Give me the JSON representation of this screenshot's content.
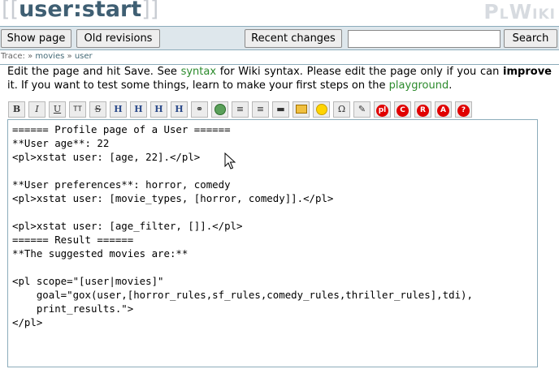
{
  "header": {
    "open_brackets": "[[",
    "page_name": "user:start",
    "close_brackets": "]]",
    "logo_big_p": "P",
    "logo_small_l": "L",
    "logo_big_w": "W",
    "logo_small_iki": "IKI"
  },
  "buttons": {
    "show_page": "Show page",
    "old_revisions": "Old revisions",
    "recent_changes": "Recent changes",
    "search": "Search"
  },
  "search": {
    "value": ""
  },
  "trace": {
    "label": "Trace:",
    "sep": "»",
    "items": [
      "movies",
      "user"
    ]
  },
  "intro": {
    "part1": "Edit the page and hit ",
    "save": "Save",
    "part2": ". See ",
    "syntax_link": "syntax",
    "part3": " for Wiki syntax. Please edit the page only if you can ",
    "improve": "improve",
    "part4": " it. If you want to test some things, learn to make your first steps on the ",
    "playground_link": "playground",
    "part5": "."
  },
  "toolbar": {
    "icons": [
      {
        "name": "bold-icon",
        "glyph": "B"
      },
      {
        "name": "italic-icon",
        "glyph": "I"
      },
      {
        "name": "underline-icon",
        "glyph": "U"
      },
      {
        "name": "monospace-icon",
        "glyph": "TT"
      },
      {
        "name": "strikethrough-icon",
        "glyph": "S"
      },
      {
        "name": "heading-same-icon",
        "glyph": "H"
      },
      {
        "name": "heading-lower-icon",
        "glyph": "H"
      },
      {
        "name": "heading-higher-icon",
        "glyph": "H"
      },
      {
        "name": "heading-menu-icon",
        "glyph": "H"
      },
      {
        "name": "link-icon",
        "glyph": "⚭"
      },
      {
        "name": "external-link-icon",
        "glyph": "globe"
      },
      {
        "name": "ordered-list-icon",
        "glyph": "≡"
      },
      {
        "name": "unordered-list-icon",
        "glyph": "≡"
      },
      {
        "name": "horizontal-rule-icon",
        "glyph": "▬"
      },
      {
        "name": "image-icon",
        "glyph": "img"
      },
      {
        "name": "smiley-icon",
        "glyph": "smile"
      },
      {
        "name": "special-chars-icon",
        "glyph": "Ω"
      },
      {
        "name": "signature-icon",
        "glyph": "✎"
      },
      {
        "name": "pl-icon",
        "glyph": "pl"
      },
      {
        "name": "c-icon",
        "glyph": "C"
      },
      {
        "name": "r-icon",
        "glyph": "R"
      },
      {
        "name": "a-icon",
        "glyph": "A"
      },
      {
        "name": "question-icon",
        "glyph": "?"
      }
    ]
  },
  "editor": {
    "content": "====== Profile page of a User ======\n**User age**: 22\n<pl>xstat user: [age, 22].</pl>\n\n**User preferences**: horror, comedy\n<pl>xstat user: [movie_types, [horror, comedy]].</pl>\n\n<pl>xstat user: [age_filter, []].</pl>\n====== Result ======\n**The suggested movies are:**\n\n<pl scope=\"[user|movies]\"\n    goal=\"gox(user,[horror_rules,sf_rules,comedy_rules,thriller_rules],tdi),\n    print_results.\">\n</pl>"
  }
}
